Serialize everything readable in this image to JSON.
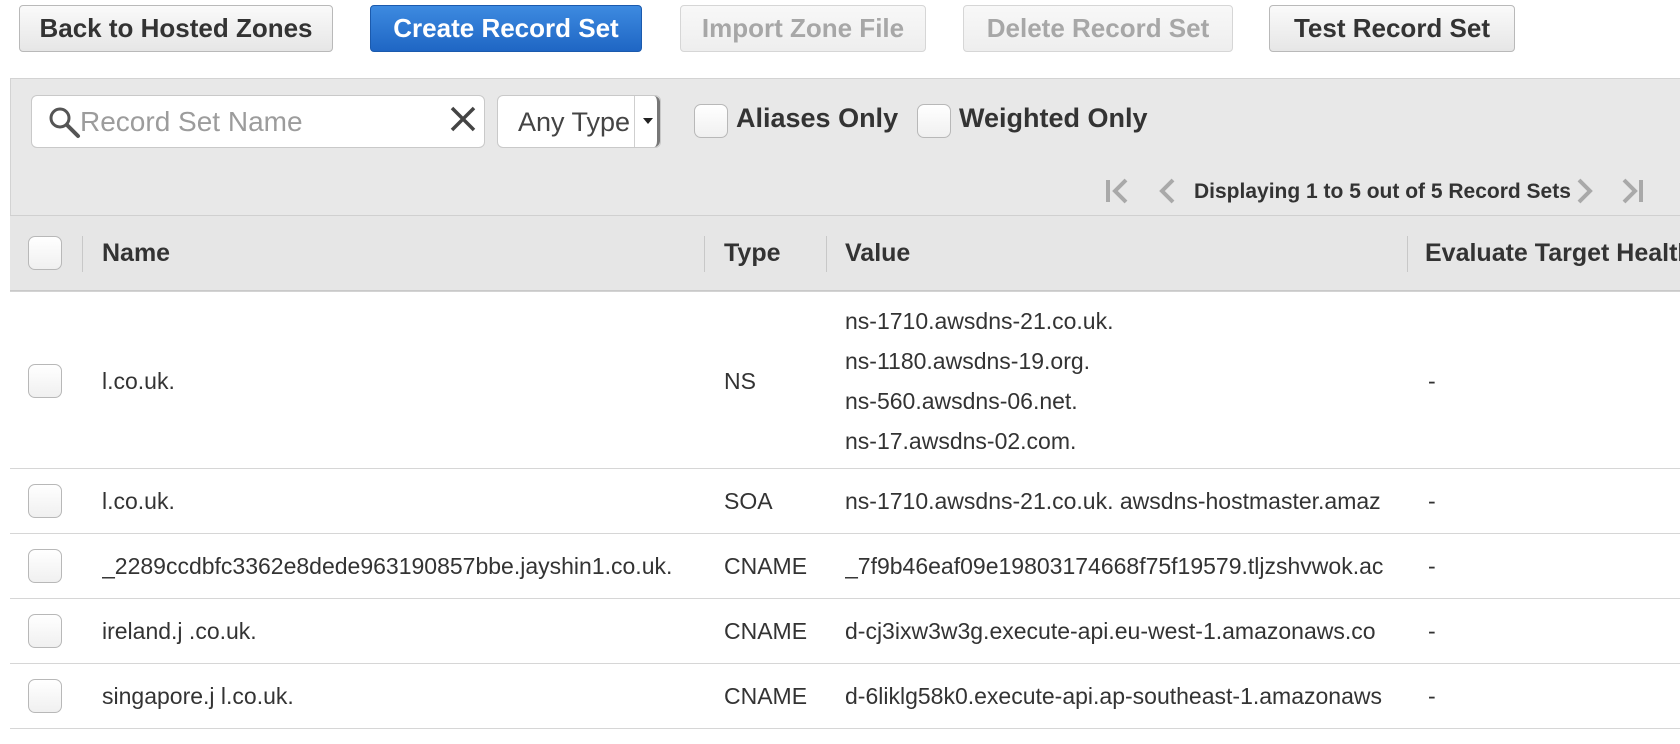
{
  "toolbar": {
    "back_label": "Back to Hosted Zones",
    "create_label": "Create Record Set",
    "import_label": "Import Zone File",
    "delete_label": "Delete Record Set",
    "test_label": "Test Record Set"
  },
  "filters": {
    "search_placeholder": "Record Set Name",
    "search_value": "",
    "type_selected": "Any Type",
    "aliases_label": "Aliases Only",
    "aliases_checked": false,
    "weighted_label": "Weighted Only",
    "weighted_checked": false
  },
  "pagination": {
    "text": "Displaying 1 to 5 out of 5 Record Sets"
  },
  "table": {
    "columns": [
      "Name",
      "Type",
      "Value",
      "Evaluate Target Health"
    ],
    "rows": [
      {
        "name": "l.co.uk.",
        "type": "NS",
        "values": [
          "ns-1710.awsdns-21.co.uk.",
          "ns-1180.awsdns-19.org.",
          "ns-560.awsdns-06.net.",
          "ns-17.awsdns-02.com."
        ],
        "eval": "-"
      },
      {
        "name": "l.co.uk.",
        "type": "SOA",
        "values": [
          "ns-1710.awsdns-21.co.uk. awsdns-hostmaster.amaz"
        ],
        "eval": "-"
      },
      {
        "name": "_2289ccdbfc3362e8dede963190857bbe.jayshin1.co.uk.",
        "type": "CNAME",
        "values": [
          "_7f9b46eaf09e19803174668f75f19579.tljzshvwok.ac"
        ],
        "eval": "-"
      },
      {
        "name": "ireland.j .co.uk.",
        "type": "CNAME",
        "values": [
          "d-cj3ixw3w3g.execute-api.eu-west-1.amazonaws.co"
        ],
        "eval": "-"
      },
      {
        "name": "singapore.j l.co.uk.",
        "type": "CNAME",
        "values": [
          "d-6liklg58k0.execute-api.ap-southeast-1.amazonaws"
        ],
        "eval": "-"
      }
    ]
  },
  "icons": {
    "search": "search-icon",
    "clear": "close-icon",
    "first": "first-page-icon",
    "prev": "prev-page-icon",
    "next": "next-page-icon",
    "last": "last-page-icon"
  },
  "colors": {
    "primary": "#2a74d0",
    "panel": "#e8e8e8",
    "disabled_text": "#a7a7a7"
  }
}
